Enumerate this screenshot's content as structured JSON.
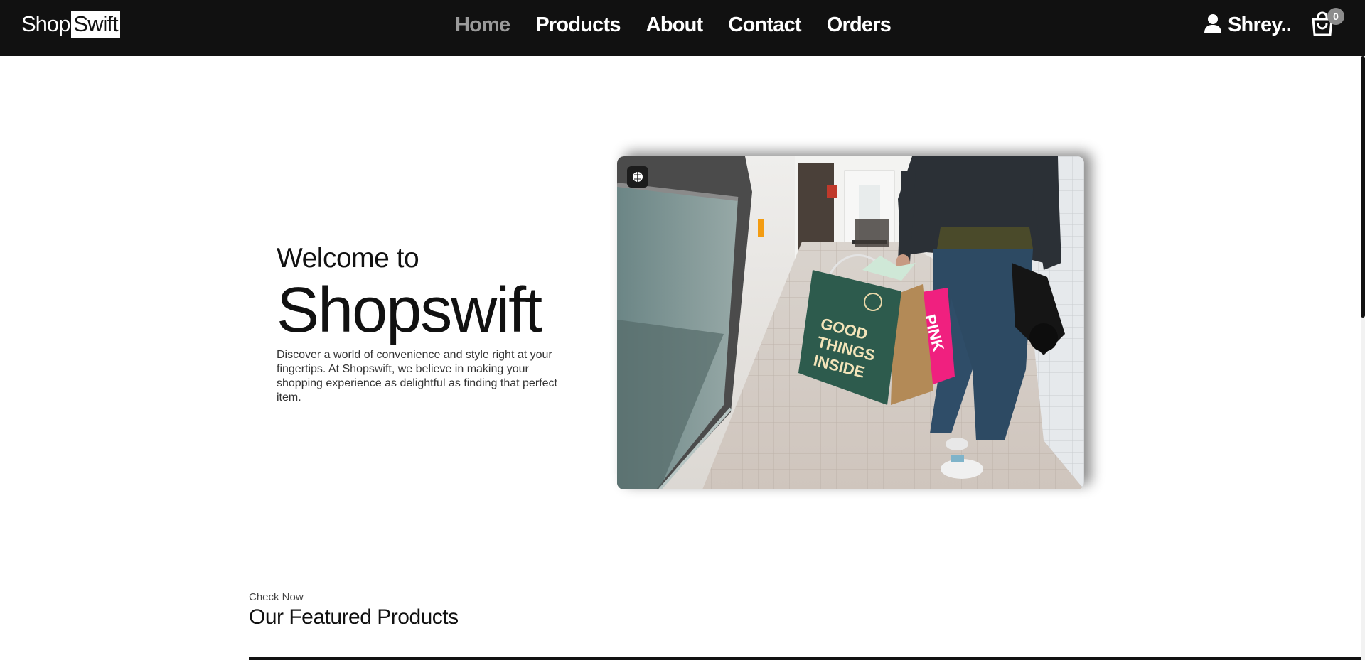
{
  "brand": {
    "part1": "Shop",
    "part2": "Swift"
  },
  "nav": {
    "links": [
      {
        "label": "Home",
        "active": true
      },
      {
        "label": "Products",
        "active": false
      },
      {
        "label": "About",
        "active": false
      },
      {
        "label": "Contact",
        "active": false
      },
      {
        "label": "Orders",
        "active": false
      }
    ]
  },
  "user": {
    "name": "Shrey..",
    "icon": "user-icon"
  },
  "cart": {
    "count": "0",
    "icon": "shopping-bag-icon"
  },
  "hero": {
    "welcome": "Welcome to",
    "title": "Shopswift",
    "description": "Discover a world of convenience and style right at your fingertips. At Shopswift, we believe in making your shopping experience as delightful as finding that perfect item.",
    "image_subject": "person walking in a mall corridor carrying shopping bags",
    "image_bag_text": "GOOD THINGS INSIDE",
    "image_pink_bag_text": "PINK"
  },
  "featured": {
    "kicker": "Check Now",
    "title": "Our Featured Products"
  },
  "colors": {
    "navbar_bg": "#111111",
    "active_link": "#9a9a9a",
    "badge_bg": "#8c8c8c"
  }
}
